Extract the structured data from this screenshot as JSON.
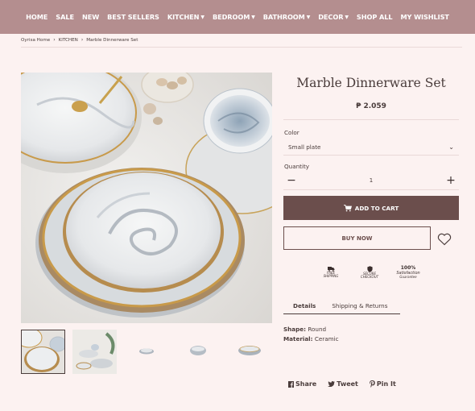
{
  "nav": {
    "items": [
      {
        "label": "HOME",
        "dropdown": false
      },
      {
        "label": "SALE",
        "dropdown": false
      },
      {
        "label": "NEW",
        "dropdown": false
      },
      {
        "label": "BEST SELLERS",
        "dropdown": false
      },
      {
        "label": "KITCHEN",
        "dropdown": true
      },
      {
        "label": "BEDROOM",
        "dropdown": true
      },
      {
        "label": "BATHROOM",
        "dropdown": true
      },
      {
        "label": "DECOR",
        "dropdown": true
      },
      {
        "label": "SHOP ALL",
        "dropdown": false
      },
      {
        "label": "MY WISHLIST",
        "dropdown": false
      }
    ]
  },
  "breadcrumb": [
    "Oyrisa Home",
    "KITCHEN",
    "Marble Dinnerware Set"
  ],
  "product": {
    "title": "Marble Dinnerware Set",
    "price": "₱ 2.059",
    "color_label": "Color",
    "color_value": "Small plate",
    "quantity_label": "Quantity",
    "quantity_value": "1",
    "add_to_cart": "ADD TO CART",
    "buy_now": "BUY NOW"
  },
  "badges": [
    {
      "line1": "FREE",
      "line2": "SHIPPING"
    },
    {
      "line1": "SECURE",
      "line2": "CHECKOUT"
    },
    {
      "line1": "100%",
      "line2": "Satisfaction",
      "line3": "Guarantee"
    }
  ],
  "tabs": [
    "Details",
    "Shipping & Returns"
  ],
  "specs": [
    {
      "key": "Shape:",
      "value": "Round"
    },
    {
      "key": "Material:",
      "value": "Ceramic"
    }
  ],
  "social": [
    "Share",
    "Tweet",
    "Pin It"
  ],
  "colors": {
    "nav_bg": "#b48e8f",
    "page_bg": "#fcf2f1",
    "accent_button": "#6b4e4c",
    "text": "#4a3c3b"
  }
}
